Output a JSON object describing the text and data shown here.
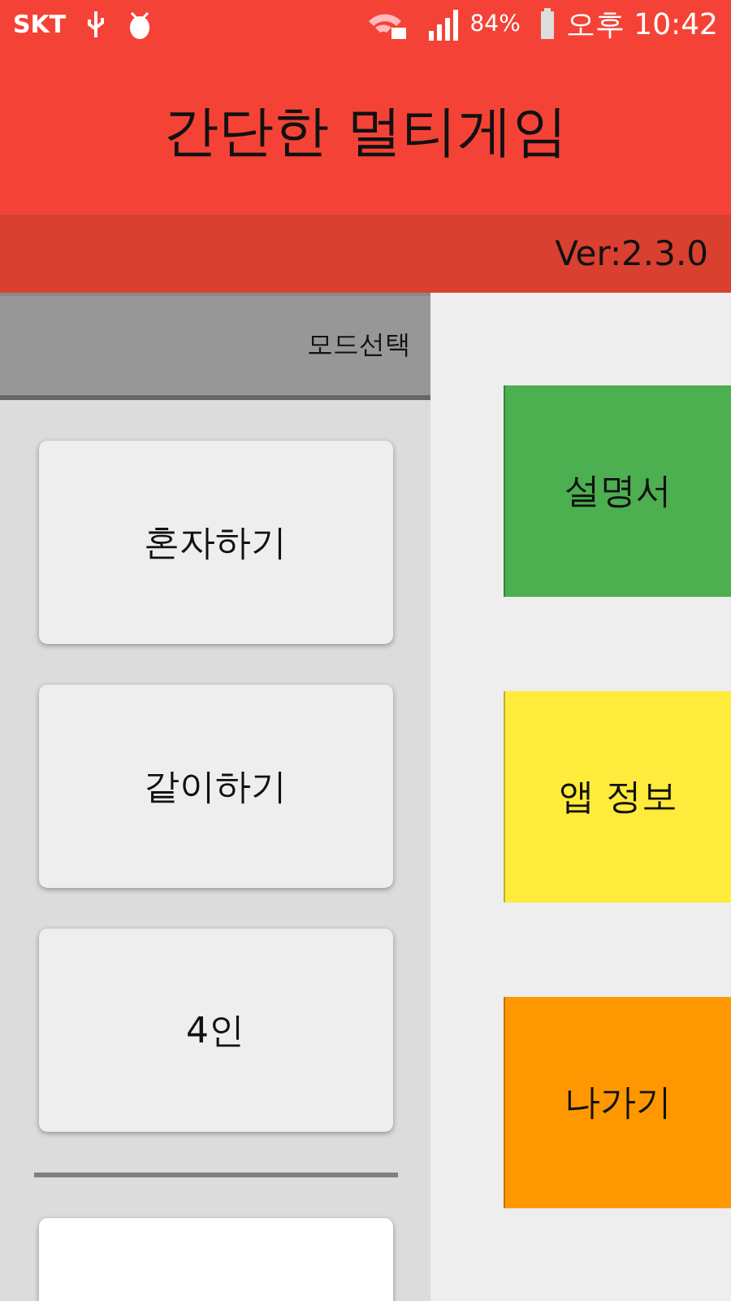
{
  "status_bar": {
    "carrier": "SKT",
    "battery": "84%",
    "time": "오후 10:42"
  },
  "app_bar": {
    "title": "간단한 멀티게임"
  },
  "version": "Ver:2.3.0",
  "mode_panel": {
    "title": "모드선택",
    "buttons": [
      {
        "label": "혼자하기",
        "kind": "mode"
      },
      {
        "label": "같이하기",
        "kind": "mode"
      },
      {
        "label": "4인",
        "kind": "mode"
      },
      {
        "kind": "extra"
      }
    ]
  },
  "side_buttons": [
    {
      "label": "설명서",
      "color": "#4caf50"
    },
    {
      "label": "앱 정보",
      "color": "#ffeb3b"
    },
    {
      "label": "나가기",
      "color": "#ff9800"
    }
  ]
}
